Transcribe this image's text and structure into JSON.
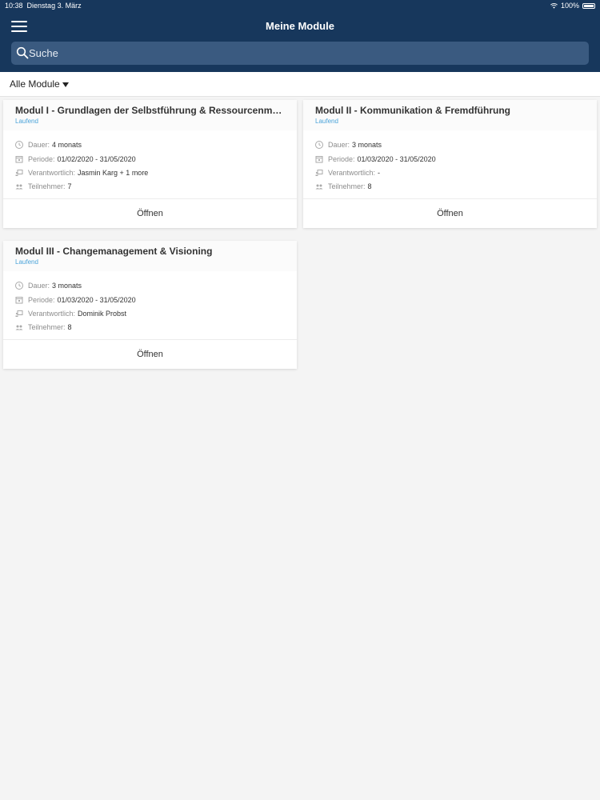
{
  "status_bar": {
    "time": "10:38",
    "date": "Dienstag 3. März",
    "battery": "100%"
  },
  "header": {
    "title": "Meine Module",
    "menu_icon": "hamburger-icon"
  },
  "search": {
    "placeholder": "Suche",
    "value": "",
    "icon": "search-icon"
  },
  "filter": {
    "label": "Alle Module",
    "icon": "caret-down-icon"
  },
  "labels": {
    "dauer": "Dauer:",
    "periode": "Periode:",
    "verantwortlich": "Verantwortlich:",
    "teilnehmer": "Teilnehmer:",
    "open": "Öffnen"
  },
  "modules": [
    {
      "title": "Modul I - Grundlagen der Selbstführung & Ressourcenmanagement",
      "status": "Laufend",
      "dauer": "4 monats",
      "periode": "01/02/2020 - 31/05/2020",
      "verantwortlich": "Jasmin Karg + 1 more",
      "teilnehmer": "7"
    },
    {
      "title": "Modul II - Kommunikation & Fremdführung",
      "status": "Laufend",
      "dauer": "3 monats",
      "periode": "01/03/2020 - 31/05/2020",
      "verantwortlich": "-",
      "teilnehmer": "8"
    },
    {
      "title": "Modul III - Changemanagement & Visioning",
      "status": "Laufend",
      "dauer": "3 monats",
      "periode": "01/03/2020 - 31/05/2020",
      "verantwortlich": "Dominik Probst",
      "teilnehmer": "8"
    }
  ],
  "colors": {
    "header_bg": "#17375c",
    "search_bg": "#3a5a80",
    "status_accent": "#4aa3d9",
    "page_bg": "#f4f4f4"
  }
}
